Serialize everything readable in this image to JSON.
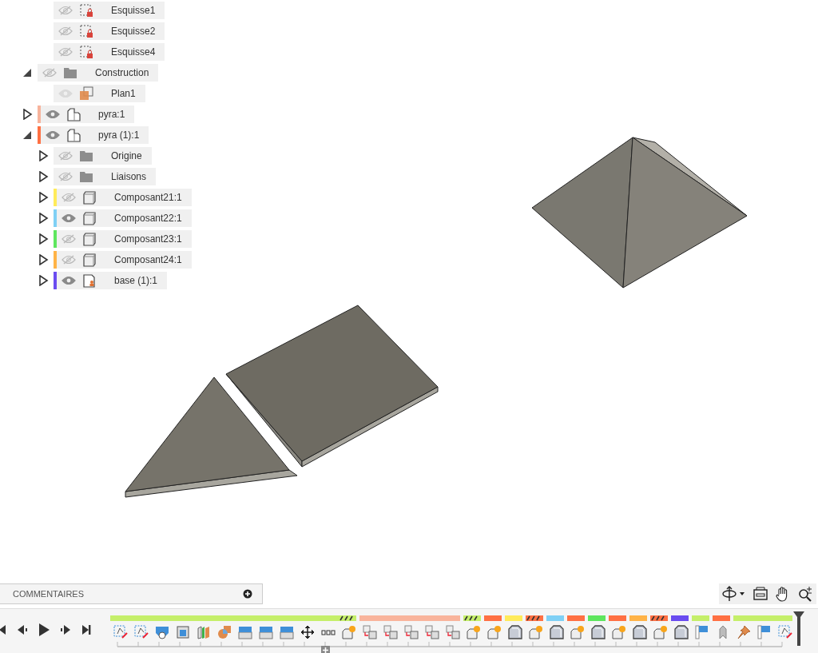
{
  "tree": {
    "partial_children": [
      {
        "label": "Esquisse1",
        "kind": "sketch",
        "visible": false
      },
      {
        "label": "Esquisse2",
        "kind": "sketch",
        "visible": false
      },
      {
        "label": "Esquisse4",
        "kind": "sketch",
        "visible": false
      }
    ],
    "nodes": [
      {
        "label": "Construction",
        "kind": "folder",
        "visible": false,
        "expanded": true,
        "children": [
          {
            "label": "Plan1",
            "kind": "plane",
            "visible": true,
            "dimmed": true
          }
        ]
      },
      {
        "label": "pyra:1",
        "kind": "component",
        "visible": true,
        "color": "#f7b39c",
        "expanded": false
      },
      {
        "label": "pyra (1):1",
        "kind": "component",
        "visible": true,
        "color": "#ff7043",
        "expanded": true,
        "children": [
          {
            "label": "Origine",
            "kind": "folder",
            "visible": false,
            "expanded": false
          },
          {
            "label": "Liaisons",
            "kind": "folder",
            "visible": false,
            "expanded": false
          },
          {
            "label": "Composant21:1",
            "kind": "body",
            "visible": false,
            "color": "#ffeb5a",
            "expanded": false
          },
          {
            "label": "Composant22:1",
            "kind": "body",
            "visible": true,
            "color": "#7fd0f5",
            "expanded": false
          },
          {
            "label": "Composant23:1",
            "kind": "body",
            "visible": false,
            "color": "#5ee65e",
            "expanded": false
          },
          {
            "label": "Composant24:1",
            "kind": "body",
            "visible": false,
            "color": "#ffb347",
            "expanded": false
          },
          {
            "label": "base (1):1",
            "kind": "linked",
            "visible": true,
            "color": "#6a4cf0",
            "expanded": false
          }
        ]
      }
    ]
  },
  "comments": {
    "label": "COMMENTAIRES"
  },
  "nav_tools": [
    {
      "kind": "orbit"
    },
    {
      "kind": "display"
    },
    {
      "kind": "pan"
    },
    {
      "kind": "zoom"
    }
  ],
  "playback": [
    {
      "kind": "first"
    },
    {
      "kind": "previous"
    },
    {
      "kind": "play"
    },
    {
      "kind": "next"
    },
    {
      "kind": "last"
    }
  ],
  "timeline": [
    {
      "color": "#c5ef6a",
      "hatched": true,
      "steps": [
        {
          "kind": "sketch"
        },
        {
          "kind": "sketch"
        },
        {
          "kind": "shell"
        },
        {
          "kind": "box"
        },
        {
          "kind": "split"
        },
        {
          "kind": "revolve"
        },
        {
          "kind": "extrude"
        },
        {
          "kind": "extrude"
        },
        {
          "kind": "extrude"
        },
        {
          "kind": "move"
        },
        {
          "kind": "pattern"
        },
        {
          "kind": "new-component"
        }
      ]
    },
    {
      "color": "#f9b49c",
      "hatched": false,
      "steps": [
        {
          "kind": "assembly"
        },
        {
          "kind": "assembly"
        },
        {
          "kind": "assembly"
        },
        {
          "kind": "assembly"
        },
        {
          "kind": "assembly"
        }
      ]
    },
    {
      "color": "#c5ef6a",
      "hatched": true,
      "steps": [
        {
          "kind": "new-component"
        }
      ]
    },
    {
      "color": "#ff7043",
      "hatched": false,
      "steps": [
        {
          "kind": "new-component"
        }
      ]
    },
    {
      "color": "#ffeb5a",
      "hatched": false,
      "steps": [
        {
          "kind": "body"
        }
      ]
    },
    {
      "color": "#ff7043",
      "hatched": true,
      "steps": [
        {
          "kind": "new-component"
        }
      ]
    },
    {
      "color": "#7fd0f5",
      "hatched": false,
      "steps": [
        {
          "kind": "body"
        }
      ]
    },
    {
      "color": "#ff7043",
      "hatched": false,
      "steps": [
        {
          "kind": "new-component"
        }
      ]
    },
    {
      "color": "#5ee65e",
      "hatched": false,
      "steps": [
        {
          "kind": "body"
        }
      ]
    },
    {
      "color": "#ff7043",
      "hatched": false,
      "steps": [
        {
          "kind": "new-component"
        }
      ]
    },
    {
      "color": "#ffb347",
      "hatched": false,
      "steps": [
        {
          "kind": "body"
        }
      ]
    },
    {
      "color": "#ff7043",
      "hatched": true,
      "steps": [
        {
          "kind": "new-component"
        }
      ]
    },
    {
      "color": "#6a4cf0",
      "hatched": false,
      "steps": [
        {
          "kind": "body"
        }
      ]
    },
    {
      "color": "#c5ef6a",
      "hatched": false,
      "steps": [
        {
          "kind": "joint-origin"
        }
      ]
    },
    {
      "color": "#ff7043",
      "hatched": false,
      "steps": [
        {
          "kind": "rigid-group"
        }
      ]
    },
    {
      "color": "#c5ef6a",
      "hatched": false,
      "steps": [
        {
          "kind": "pin"
        },
        {
          "kind": "joint-origin"
        },
        {
          "kind": "sketch"
        }
      ]
    }
  ]
}
